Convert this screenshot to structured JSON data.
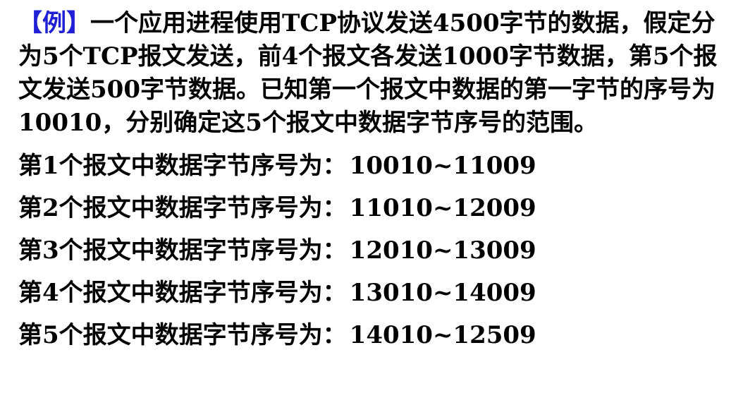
{
  "problem": {
    "tag": "【例】",
    "text": "一个应用进程使用TCP协议发送4500字节的数据，假定分为5个TCP报文发送，前4个报文各发送1000字节数据，第5个报文发送500字节数据。已知第一个报文中数据的第一字节的序号为10010，分别确定这5个报文中数据字节序号的范围。"
  },
  "answers": [
    {
      "label": "第1个报文中数据字节序号为：",
      "range": "10010~11009"
    },
    {
      "label": "第2个报文中数据字节序号为：",
      "range": "11010~12009"
    },
    {
      "label": "第3个报文中数据字节序号为：",
      "range": "12010~13009"
    },
    {
      "label": "第4个报文中数据字节序号为：",
      "range": "13010~14009"
    },
    {
      "label": "第5个报文中数据字节序号为：",
      "range": "14010~12509"
    }
  ],
  "colors": {
    "tag": "#1f1fd6",
    "text": "#000000"
  }
}
